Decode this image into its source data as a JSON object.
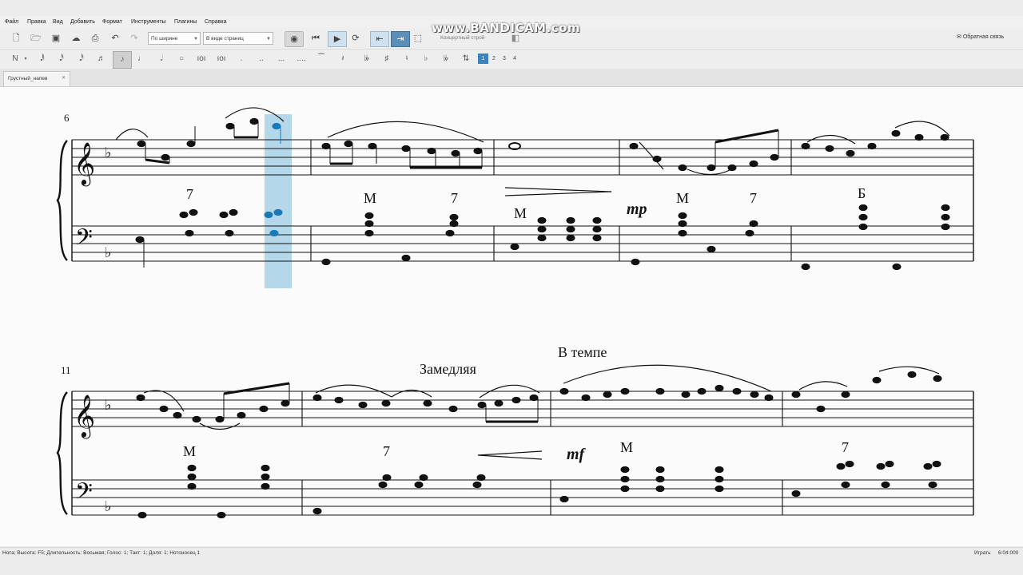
{
  "menu": [
    "Файл",
    "Правка",
    "Вид",
    "Добавить",
    "Формат",
    "Инструменты",
    "Плагины",
    "Справка"
  ],
  "toolbar": {
    "zoom_value": "По ширине",
    "view_mode": "В виде страниц",
    "concert_pitch": "Концертный строй",
    "feedback": "Обратная связь"
  },
  "voices": [
    "1",
    "2",
    "3",
    "4"
  ],
  "watermark": "www.BANDICAM.com",
  "tab": {
    "label": "Грустный_напев",
    "close": "✕"
  },
  "score": {
    "system1": {
      "measure_number": "6",
      "annotations": [
        "7",
        "М",
        "7",
        "М",
        "mp",
        "М",
        "7",
        "Б"
      ]
    },
    "system2": {
      "measure_number": "11",
      "tempo_slow": "Замедляя",
      "tempo_a": "В темпе",
      "annotations": [
        "М",
        "7",
        "mf",
        "М",
        "7"
      ]
    }
  },
  "status": {
    "left": "Нота; Высота: F5; Длительность: Восьмая; Голос: 1;  Такт: 1; Доля: 1; Нотоносец 1",
    "mode": "Играть",
    "time": "6:04:000"
  },
  "colors": {
    "selection": "#a8d0e6",
    "accent": "#1a7ab8",
    "active_button": "#4a90c8"
  }
}
